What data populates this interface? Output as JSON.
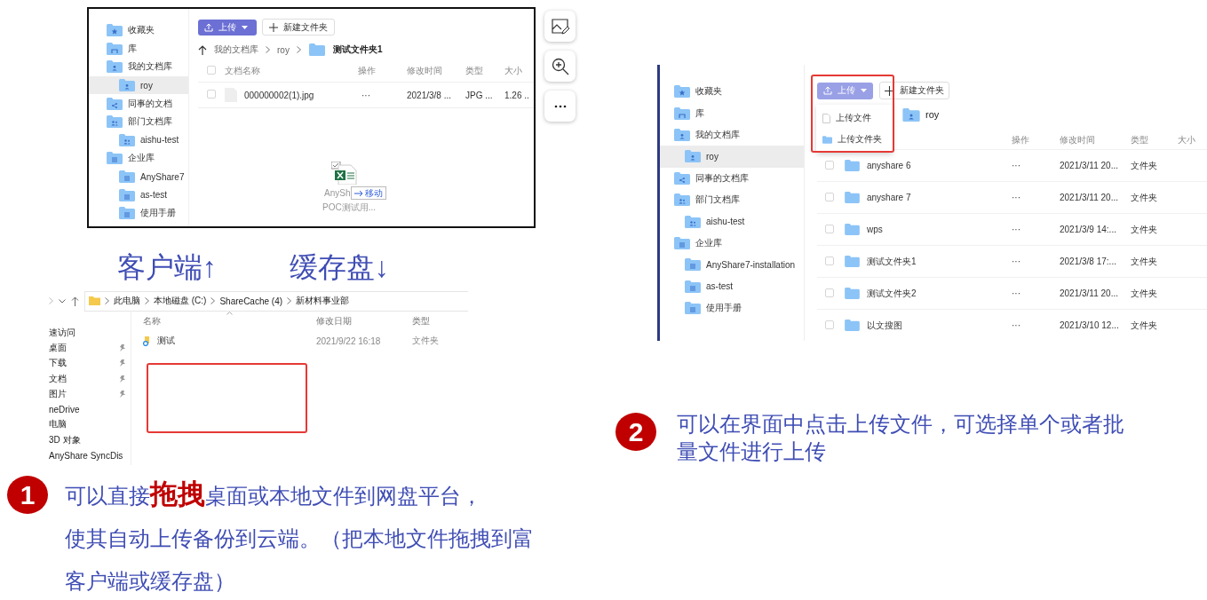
{
  "client_window": {
    "sidebar": [
      {
        "label": "收藏夹",
        "kind": "favorites",
        "selected": false
      },
      {
        "label": "库",
        "kind": "library",
        "selected": false
      },
      {
        "label": "我的文档库",
        "kind": "personal",
        "selected": false,
        "children": [
          {
            "label": "roy",
            "kind": "personal",
            "selected": true
          }
        ]
      },
      {
        "label": "同事的文档",
        "kind": "shared",
        "selected": false
      },
      {
        "label": "部门文档库",
        "kind": "department",
        "selected": false,
        "children": [
          {
            "label": "aishu-test",
            "kind": "department",
            "selected": false
          }
        ]
      },
      {
        "label": "企业库",
        "kind": "enterprise",
        "selected": false,
        "children": [
          {
            "label": "AnyShare7",
            "kind": "enterprise",
            "selected": false
          },
          {
            "label": "as-test",
            "kind": "enterprise",
            "selected": false
          },
          {
            "label": "使用手册",
            "kind": "enterprise",
            "selected": false
          }
        ]
      }
    ],
    "toolbar": {
      "upload": "上传",
      "new_folder": "新建文件夹",
      "expanded": false
    },
    "breadcrumb": [
      "我的文档库",
      "roy",
      "测试文件夹1"
    ],
    "select_all": false,
    "columns": [
      "文档名称",
      "操作",
      "修改时间",
      "类型",
      "大小"
    ],
    "rows": [
      {
        "name": "000000002(1).jpg",
        "action": "···",
        "modified": "2021/3/8 ...",
        "type": "JPG ...",
        "size": "1.26 ..",
        "checked": false
      }
    ],
    "drag_preview": {
      "file_name": "AnySh",
      "subtitle": "POC测试用...",
      "tooltip": "移动"
    }
  },
  "captions": [
    "客户端↑",
    "缓存盘↓"
  ],
  "explorer": {
    "breadcrumb": [
      "此电脑",
      "本地磁盘 (C:)",
      "ShareCache (4)",
      "新材料事业部"
    ],
    "nav": [
      {
        "label": "速访问",
        "pinned": false
      },
      {
        "label": "桌面",
        "pinned": true
      },
      {
        "label": "下载",
        "pinned": true
      },
      {
        "label": "文档",
        "pinned": true
      },
      {
        "label": "图片",
        "pinned": true
      },
      {
        "label": "neDrive",
        "pinned": false
      },
      {
        "label": "电脑",
        "pinned": false
      },
      {
        "label": "3D 对象",
        "pinned": false
      },
      {
        "label": "AnyShare SyncDis",
        "pinned": false
      }
    ],
    "columns": [
      "名称",
      "修改日期",
      "类型"
    ],
    "rows": [
      {
        "name": "测试",
        "modified": "2021/9/22 16:18",
        "type": "文件夹"
      }
    ]
  },
  "web_window": {
    "sidebar": [
      {
        "label": "收藏夹",
        "kind": "favorites",
        "selected": false
      },
      {
        "label": "库",
        "kind": "library",
        "selected": false
      },
      {
        "label": "我的文档库",
        "kind": "personal",
        "selected": false,
        "children": [
          {
            "label": "roy",
            "kind": "personal",
            "selected": true
          }
        ]
      },
      {
        "label": "同事的文档库",
        "kind": "shared",
        "selected": false
      },
      {
        "label": "部门文档库",
        "kind": "department",
        "selected": false,
        "children": [
          {
            "label": "aishu-test",
            "kind": "department",
            "selected": false
          }
        ]
      },
      {
        "label": "企业库",
        "kind": "enterprise",
        "selected": false,
        "children": [
          {
            "label": "AnyShare7-installation",
            "kind": "enterprise",
            "selected": false
          },
          {
            "label": "as-test",
            "kind": "enterprise",
            "selected": false
          },
          {
            "label": "使用手册",
            "kind": "enterprise",
            "selected": false
          }
        ]
      }
    ],
    "toolbar": {
      "upload": "上传",
      "new_folder": "新建文件夹",
      "expanded": true
    },
    "upload_menu": [
      {
        "label": "上传文件",
        "kind": "file"
      },
      {
        "label": "上传文件夹",
        "kind": "folder"
      }
    ],
    "breadcrumb": [
      "roy"
    ],
    "columns": [
      "操作",
      "修改时间",
      "类型",
      "大小"
    ],
    "rows": [
      {
        "name": "anyshare 6",
        "action": "···",
        "modified": "2021/3/11 20...",
        "type": "文件夹",
        "checked": false
      },
      {
        "name": "anyshare 7",
        "action": "···",
        "modified": "2021/3/11 20...",
        "type": "文件夹",
        "checked": false
      },
      {
        "name": "wps",
        "action": "···",
        "modified": "2021/3/9 14:...",
        "type": "文件夹",
        "checked": false
      },
      {
        "name": "测试文件夹1",
        "action": "···",
        "modified": "2021/3/8 17:...",
        "type": "文件夹",
        "checked": false
      },
      {
        "name": "测试文件夹2",
        "action": "···",
        "modified": "2021/3/11 20...",
        "type": "文件夹",
        "checked": false
      },
      {
        "name": "以文搜图",
        "action": "···",
        "modified": "2021/3/10 12...",
        "type": "文件夹",
        "checked": false
      }
    ]
  },
  "notes": [
    {
      "number": "1",
      "lines": [
        "可以直接**拖拽**桌面或本地文件到网盘平台，",
        "使其自动上传备份到云端。（把本地文件拖拽到富",
        "客户端或缓存盘）"
      ]
    },
    {
      "number": "2",
      "lines": [
        "可以在界面中点击上传文件，可选择单个或者批量文件进行上传"
      ]
    }
  ]
}
